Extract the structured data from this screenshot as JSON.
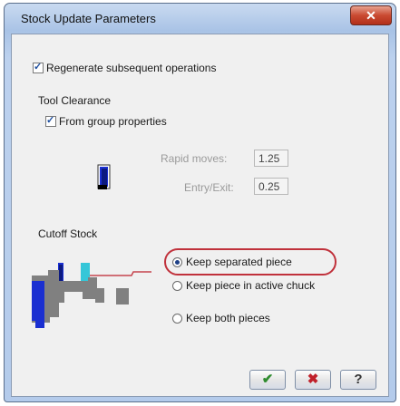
{
  "window": {
    "title": "Stock Update Parameters"
  },
  "regenerate": {
    "label": "Regenerate subsequent operations",
    "checked": true
  },
  "tool_clearance": {
    "heading": "Tool Clearance",
    "from_group": {
      "label": "From group properties",
      "checked": true
    },
    "rapid_label": "Rapid moves:",
    "rapid_value": "1.25",
    "entry_label": "Entry/Exit:",
    "entry_value": "0.25"
  },
  "cutoff_stock": {
    "heading": "Cutoff Stock",
    "options": [
      {
        "label": "Keep separated piece",
        "selected": true
      },
      {
        "label": "Keep piece in active chuck",
        "selected": false
      },
      {
        "label": "Keep both pieces",
        "selected": false
      }
    ]
  },
  "buttons": {
    "ok": "✔",
    "cancel": "✖",
    "help": "?"
  },
  "colors": {
    "ok": "#2e8b2e",
    "cancel": "#c0202a",
    "help": "#333333",
    "highlight": "#c0313b",
    "stock_blue": "#1a2fd1",
    "stock_gray": "#808080",
    "tool_cyan": "#35c6d8"
  }
}
